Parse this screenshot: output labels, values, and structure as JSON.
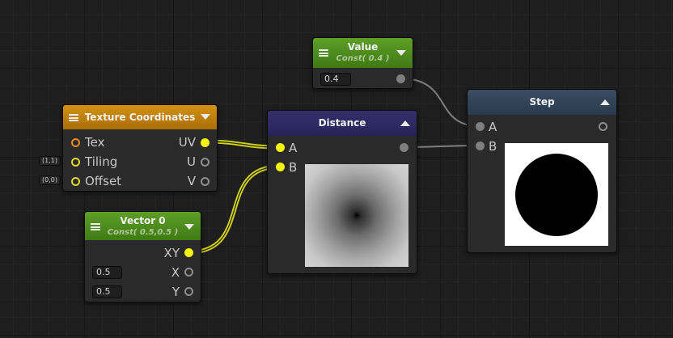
{
  "colors": {
    "background": "#1e1e1e",
    "node_body": "#2a2a2a",
    "header_value": "#4a8a1e",
    "header_texture": "#c8860e",
    "header_distance": "#2e2a5e",
    "header_vector": "#4a8a1e",
    "header_step": "#2e3e52",
    "wire_yellow": "#f7f50a",
    "wire_gray": "#7e7e7e"
  },
  "value_node": {
    "title": "Value",
    "subtitle": "Const( 0.4 )",
    "field": "0.4"
  },
  "texture_node": {
    "title": "Texture Coordinates",
    "inputs": [
      "Tex",
      "Tiling",
      "Offset"
    ],
    "outputs": [
      "UV",
      "U",
      "V"
    ],
    "defaults": {
      "tiling": "(1,1)",
      "offset": "(0,0)"
    }
  },
  "distance_node": {
    "title": "Distance",
    "inputs": [
      "A",
      "B"
    ]
  },
  "vector_node": {
    "title": "Vector 0",
    "subtitle": "Const( 0.5,0.5 )",
    "outputs": [
      "XY",
      "X",
      "Y"
    ],
    "fields": {
      "x": "0.5",
      "y": "0.5"
    }
  },
  "step_node": {
    "title": "Step",
    "inputs": [
      "A",
      "B"
    ]
  }
}
